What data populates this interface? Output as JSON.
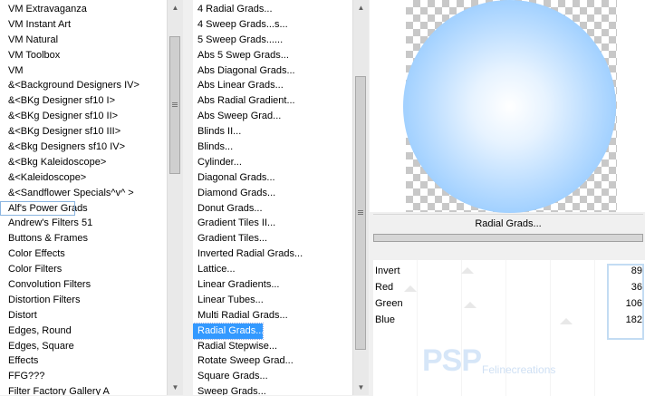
{
  "categories": [
    "VM Extravaganza",
    "VM Instant Art",
    "VM Natural",
    "VM Toolbox",
    "VM",
    "&<Background Designers IV>",
    "&<BKg Designer sf10 I>",
    "&<BKg Designer sf10 II>",
    "&<BKg Designer sf10 III>",
    "&<Bkg Designers sf10 IV>",
    "&<Bkg Kaleidoscope>",
    "&<Kaleidoscope>",
    "&<Sandflower Specials^v^ >",
    "Alf's Power Grads",
    "Andrew's Filters 51",
    "Buttons & Frames",
    "Color Effects",
    "Color Filters",
    "Convolution Filters",
    "Distortion Filters",
    "Distort",
    "Edges, Round",
    "Edges, Square",
    "Effects",
    "FFG???",
    "Filter Factory Gallery A"
  ],
  "filters": [
    "4 Radial Grads...",
    "4 Sweep Grads...s...",
    "5 Sweep Grads......",
    "Abs 5 Swep Grads...",
    "Abs Diagonal Grads...",
    "Abs Linear Grads...",
    "Abs Radial Gradient...",
    "Abs Sweep Grad...",
    "Blinds II...",
    "Blinds...",
    "Cylinder...",
    "Diagonal Grads...",
    "Diamond Grads...",
    "Donut Grads...",
    "Gradient Tiles II...",
    "Gradient Tiles...",
    "Inverted Radial Grads...",
    "Lattice...",
    "Linear Gradients...",
    "Linear Tubes...",
    "Multi Radial Grads...",
    "Radial Grads...",
    "Radial Stepwise...",
    "Rotate Sweep Grad...",
    "Square Grads...",
    "Sweep Grads..."
  ],
  "selected_filter": "Radial Grads...",
  "focused_category": "Alf's Power Grads",
  "filter_title": "Radial Grads...",
  "params": [
    {
      "label": "Invert",
      "value": "89"
    },
    {
      "label": "Red",
      "value": "36"
    },
    {
      "label": "Green",
      "value": "106"
    },
    {
      "label": "Blue",
      "value": "182"
    }
  ],
  "watermark": {
    "logo": "PSP",
    "text": "Felinecreations"
  },
  "icons": {
    "scroll_up": "triangle-up-icon",
    "scroll_down": "triangle-down-icon",
    "grip": "grip-icon"
  },
  "colors": {
    "selection": "#3399ff",
    "sphere_outer": "#79bcff",
    "sphere_inner": "#ffffff",
    "focus": "#8ab4e0"
  }
}
